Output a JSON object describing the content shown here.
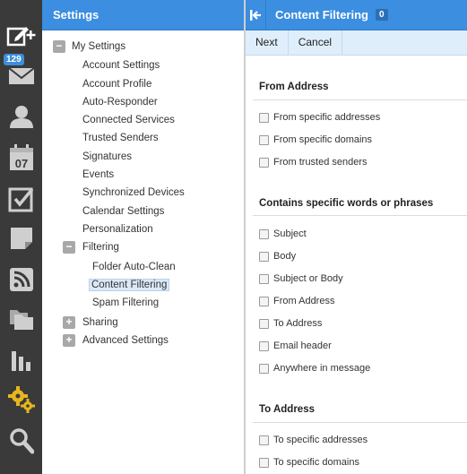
{
  "rail": {
    "mail_badge": "129",
    "icons": [
      "compose-icon",
      "mail-icon",
      "contacts-icon",
      "calendar-icon",
      "tasks-icon",
      "notes-icon",
      "rss-icon",
      "files-icon",
      "reports-icon",
      "settings-icon",
      "search-icon"
    ],
    "calendar_day": "07"
  },
  "settings": {
    "title": "Settings",
    "tree": {
      "my_settings": "My Settings",
      "items": [
        "Account Settings",
        "Account Profile",
        "Auto-Responder",
        "Connected Services",
        "Trusted Senders",
        "Signatures",
        "Events",
        "Synchronized Devices",
        "Calendar Settings",
        "Personalization"
      ],
      "filtering": "Filtering",
      "filtering_items": [
        "Folder Auto-Clean",
        "Content Filtering",
        "Spam Filtering"
      ],
      "sharing": "Sharing",
      "advanced": "Advanced Settings"
    }
  },
  "content": {
    "title": "Content Filtering",
    "count": "0",
    "toolbar": {
      "next": "Next",
      "cancel": "Cancel"
    },
    "sections": [
      {
        "title": "From Address",
        "options": [
          "From specific addresses",
          "From specific domains",
          "From trusted senders"
        ]
      },
      {
        "title": "Contains specific words or phrases",
        "options": [
          "Subject",
          "Body",
          "Subject or Body",
          "From Address",
          "To Address",
          "Email header",
          "Anywhere in message"
        ]
      },
      {
        "title": "To Address",
        "options": [
          "To specific addresses",
          "To specific domains"
        ]
      }
    ]
  },
  "colors": {
    "accent": "#3b8ee0",
    "rail": "#3a3a3a",
    "toolbar": "#dfeefb"
  }
}
